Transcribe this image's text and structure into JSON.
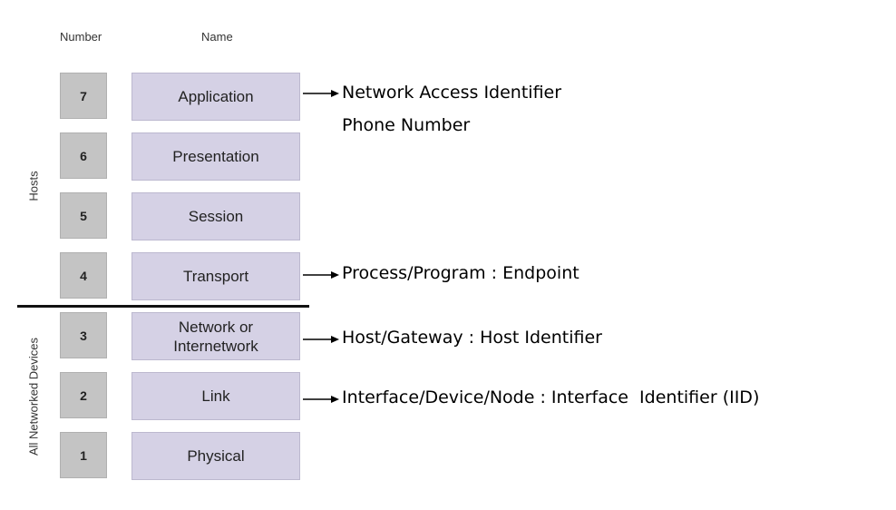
{
  "headers": {
    "number": "Number",
    "name": "Name"
  },
  "groups": {
    "hosts": "Hosts",
    "all_devices": "All Networked Devices"
  },
  "layers": [
    {
      "number": "7",
      "name": "Application"
    },
    {
      "number": "6",
      "name": "Presentation"
    },
    {
      "number": "5",
      "name": "Session"
    },
    {
      "number": "4",
      "name": "Transport"
    },
    {
      "number": "3",
      "name": "Network or\nInternetwork"
    },
    {
      "number": "2",
      "name": "Link"
    },
    {
      "number": "1",
      "name": "Physical"
    }
  ],
  "annotations": {
    "application_1": "Network Access Identifier",
    "application_2": "Phone Number",
    "transport": "Process/Program : Endpoint",
    "network": "Host/Gateway : Host Identifier",
    "link": "Interface/Device/Node : Interface  Identifier (IID)"
  },
  "colors": {
    "number_box": "#c4c4c4",
    "name_box": "#d5d1e5"
  }
}
